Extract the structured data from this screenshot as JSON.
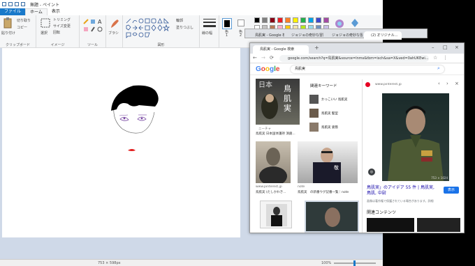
{
  "paint": {
    "title": "無題 - ペイント",
    "tabs": [
      "ファイル",
      "ホーム",
      "表示"
    ],
    "groups": {
      "clipboard": {
        "label": "クリップボード",
        "paste": "貼り付け",
        "cut": "切り取り",
        "copy": "コピー"
      },
      "image": {
        "label": "イメージ",
        "select": "選択",
        "crop": "トリミング",
        "resize": "サイズ変更",
        "rotate": "回転"
      },
      "tools": {
        "label": "ツール"
      },
      "brush": {
        "label": "ブラシ"
      },
      "shapes": {
        "label": "図形",
        "outline": "輪郭",
        "fill": "塗りつぶし"
      },
      "size": {
        "label": "線の幅"
      },
      "color1": {
        "label": "色\n1"
      },
      "color2": {
        "label": "色\n2"
      }
    },
    "palette": [
      "#000000",
      "#7f7f7f",
      "#880015",
      "#ed1c24",
      "#ff7f27",
      "#fff200",
      "#22b14c",
      "#00a2e8",
      "#3f48cc",
      "#a349a4",
      "#ffffff",
      "#c3c3c3",
      "#b97a57",
      "#ffaec9",
      "#ffc90e",
      "#efe4b0",
      "#b5e61d",
      "#99d9ea",
      "#7092be",
      "#c8bfe7"
    ],
    "status": {
      "size": "753 × 598px",
      "zoom": "100%"
    }
  },
  "chrome": {
    "tabs": [
      {
        "label": "鳥肌実 - Google 検索"
      },
      {
        "label": "ジョジョの奇妙な冒険の..."
      },
      {
        "label": "ジョジョの奇妙な冒険..."
      },
      {
        "label": "(2) オリジナル..."
      }
    ],
    "url": "google.com/search?q=鳥肌実&source=lnms&tbm=isch&sa=X&ved=0ahUKEwi...",
    "search_query": "鳥肌実",
    "results": [
      {
        "src": "ニーチャ",
        "title": "鳥肌実 日本国体護持 演劇..."
      },
      {
        "src": "www.pinterest.jp",
        "title": "鳥肌実 (たしかわき..."
      },
      {
        "src": "note",
        "title": "鳥肌実　の新番ウグ記番一覧｜note"
      }
    ],
    "related": {
      "heading": "関連キーワード",
      "items": [
        "かっこいい 鳥肌実",
        "鳥肌実 髪型",
        "鳥肌実 姿態"
      ]
    },
    "panel": {
      "site": "www.pinterest.jp",
      "title": "鳥肌実」のアイデア 55 件 | 鳥肌実, 鳥肌, 中尉",
      "note": "画像は著作権で保護されている場合があります。詳細",
      "visit": "表示",
      "related_heading": "関連コンテンツ",
      "dims": "753 × 1024"
    }
  }
}
